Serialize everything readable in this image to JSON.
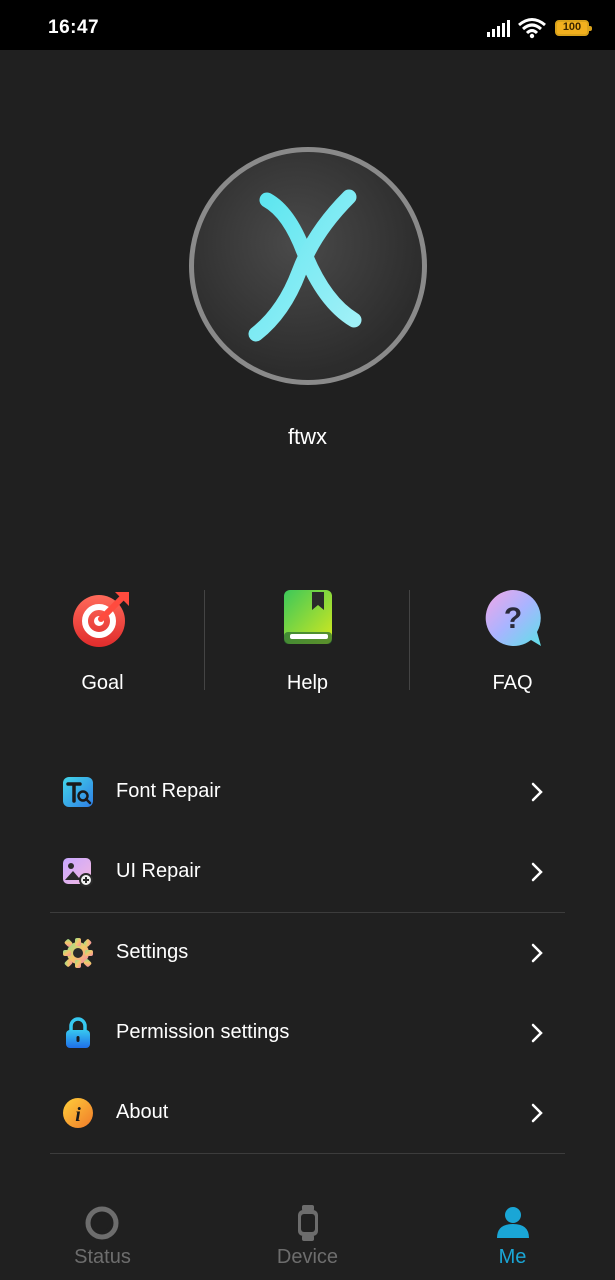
{
  "status_bar": {
    "time": "16:47",
    "battery": "100",
    "icons": [
      "signal-icon",
      "wifi-icon",
      "battery-icon"
    ]
  },
  "profile": {
    "avatar_icon": "x-logo-icon",
    "username": "ftwx"
  },
  "quick_actions": [
    {
      "label": "Goal",
      "icon": "target-icon",
      "color": "#e8413c"
    },
    {
      "label": "Help",
      "icon": "book-icon",
      "color": "#7ed321"
    },
    {
      "label": "FAQ",
      "icon": "question-bubble-icon",
      "color": "#8fb8ff"
    }
  ],
  "menu": {
    "items": [
      {
        "label": "Font Repair",
        "icon": "font-repair-icon"
      },
      {
        "label": "UI Repair",
        "icon": "ui-repair-icon"
      },
      {
        "label": "Settings",
        "icon": "gear-icon"
      },
      {
        "label": "Permission settings",
        "icon": "lock-icon"
      },
      {
        "label": "About",
        "icon": "info-icon"
      }
    ]
  },
  "bottom_nav": {
    "items": [
      {
        "label": "Status",
        "icon": "status-ring-icon",
        "active": false
      },
      {
        "label": "Device",
        "icon": "watch-icon",
        "active": false
      },
      {
        "label": "Me",
        "icon": "person-icon",
        "active": true
      }
    ],
    "active_color": "#1aa6d6",
    "inactive_color": "#6d6d6d"
  }
}
